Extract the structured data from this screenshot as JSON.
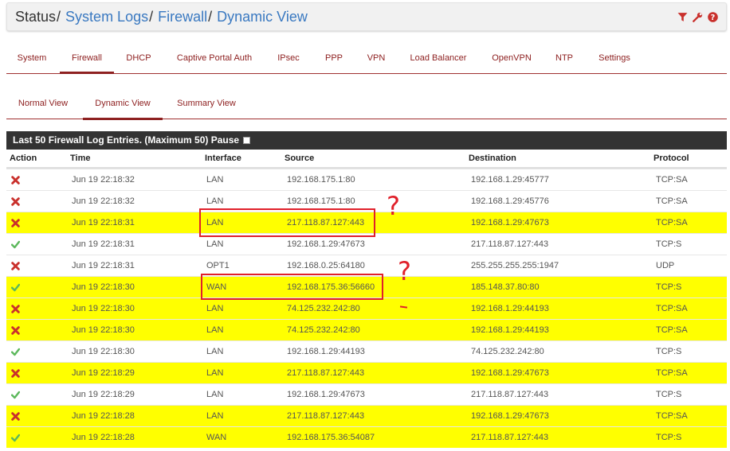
{
  "breadcrumb": {
    "items": [
      "Status",
      "System Logs",
      "Firewall",
      "Dynamic View"
    ],
    "separator": "/"
  },
  "header_icons": [
    "filter-icon",
    "wrench-icon",
    "help-icon"
  ],
  "main_tabs": [
    {
      "label": "System",
      "active": false
    },
    {
      "label": "Firewall",
      "active": true
    },
    {
      "label": "DHCP",
      "active": false
    },
    {
      "label": "Captive Portal Auth",
      "active": false
    },
    {
      "label": "IPsec",
      "active": false
    },
    {
      "label": "PPP",
      "active": false
    },
    {
      "label": "VPN",
      "active": false
    },
    {
      "label": "Load Balancer",
      "active": false
    },
    {
      "label": "OpenVPN",
      "active": false
    },
    {
      "label": "NTP",
      "active": false
    },
    {
      "label": "Settings",
      "active": false
    }
  ],
  "sub_tabs": [
    {
      "label": "Normal View",
      "active": false
    },
    {
      "label": "Dynamic View",
      "active": true
    },
    {
      "label": "Summary View",
      "active": false
    }
  ],
  "panel": {
    "title": "Last 50 Firewall Log Entries. (Maximum 50)",
    "pause_label": "Pause"
  },
  "columns": {
    "action": "Action",
    "time": "Time",
    "interface": "Interface",
    "source": "Source",
    "destination": "Destination",
    "protocol": "Protocol"
  },
  "rows": [
    {
      "action": "block",
      "time": "Jun 19 22:18:32",
      "interface": "LAN",
      "source": "192.168.175.1:80",
      "destination": "192.168.1.29:45777",
      "protocol": "TCP:SA",
      "highlight": false
    },
    {
      "action": "block",
      "time": "Jun 19 22:18:32",
      "interface": "LAN",
      "source": "192.168.175.1:80",
      "destination": "192.168.1.29:45776",
      "protocol": "TCP:SA",
      "highlight": false
    },
    {
      "action": "block",
      "time": "Jun 19 22:18:31",
      "interface": "LAN",
      "source": "217.118.87.127:443",
      "destination": "192.168.1.29:47673",
      "protocol": "TCP:SA",
      "highlight": true
    },
    {
      "action": "pass",
      "time": "Jun 19 22:18:31",
      "interface": "LAN",
      "source": "192.168.1.29:47673",
      "destination": "217.118.87.127:443",
      "protocol": "TCP:S",
      "highlight": false
    },
    {
      "action": "block",
      "time": "Jun 19 22:18:31",
      "interface": "OPT1",
      "source": "192.168.0.25:64180",
      "destination": "255.255.255.255:1947",
      "protocol": "UDP",
      "highlight": false
    },
    {
      "action": "pass",
      "time": "Jun 19 22:18:30",
      "interface": "WAN",
      "source": "192.168.175.36:56660",
      "destination": "185.148.37.80:80",
      "protocol": "TCP:S",
      "highlight": true
    },
    {
      "action": "block",
      "time": "Jun 19 22:18:30",
      "interface": "LAN",
      "source": "74.125.232.242:80",
      "destination": "192.168.1.29:44193",
      "protocol": "TCP:SA",
      "highlight": true
    },
    {
      "action": "block",
      "time": "Jun 19 22:18:30",
      "interface": "LAN",
      "source": "74.125.232.242:80",
      "destination": "192.168.1.29:44193",
      "protocol": "TCP:SA",
      "highlight": true
    },
    {
      "action": "pass",
      "time": "Jun 19 22:18:30",
      "interface": "LAN",
      "source": "192.168.1.29:44193",
      "destination": "74.125.232.242:80",
      "protocol": "TCP:S",
      "highlight": false
    },
    {
      "action": "block",
      "time": "Jun 19 22:18:29",
      "interface": "LAN",
      "source": "217.118.87.127:443",
      "destination": "192.168.1.29:47673",
      "protocol": "TCP:SA",
      "highlight": true
    },
    {
      "action": "pass",
      "time": "Jun 19 22:18:29",
      "interface": "LAN",
      "source": "192.168.1.29:47673",
      "destination": "217.118.87.127:443",
      "protocol": "TCP:S",
      "highlight": false
    },
    {
      "action": "block",
      "time": "Jun 19 22:18:28",
      "interface": "LAN",
      "source": "217.118.87.127:443",
      "destination": "192.168.1.29:47673",
      "protocol": "TCP:SA",
      "highlight": true
    },
    {
      "action": "pass",
      "time": "Jun 19 22:18:28",
      "interface": "WAN",
      "source": "192.168.175.36:54087",
      "destination": "217.118.87.127:443",
      "protocol": "TCP:S",
      "highlight": true
    }
  ],
  "annotations": {
    "mark": "?"
  },
  "colors": {
    "link": "#3a79c1",
    "tab_text": "#8e2121",
    "highlight": "#ffff00",
    "block": "#c9302c",
    "pass": "#5cb85c",
    "annotation": "#e0202a",
    "panel_head": "#333333"
  }
}
